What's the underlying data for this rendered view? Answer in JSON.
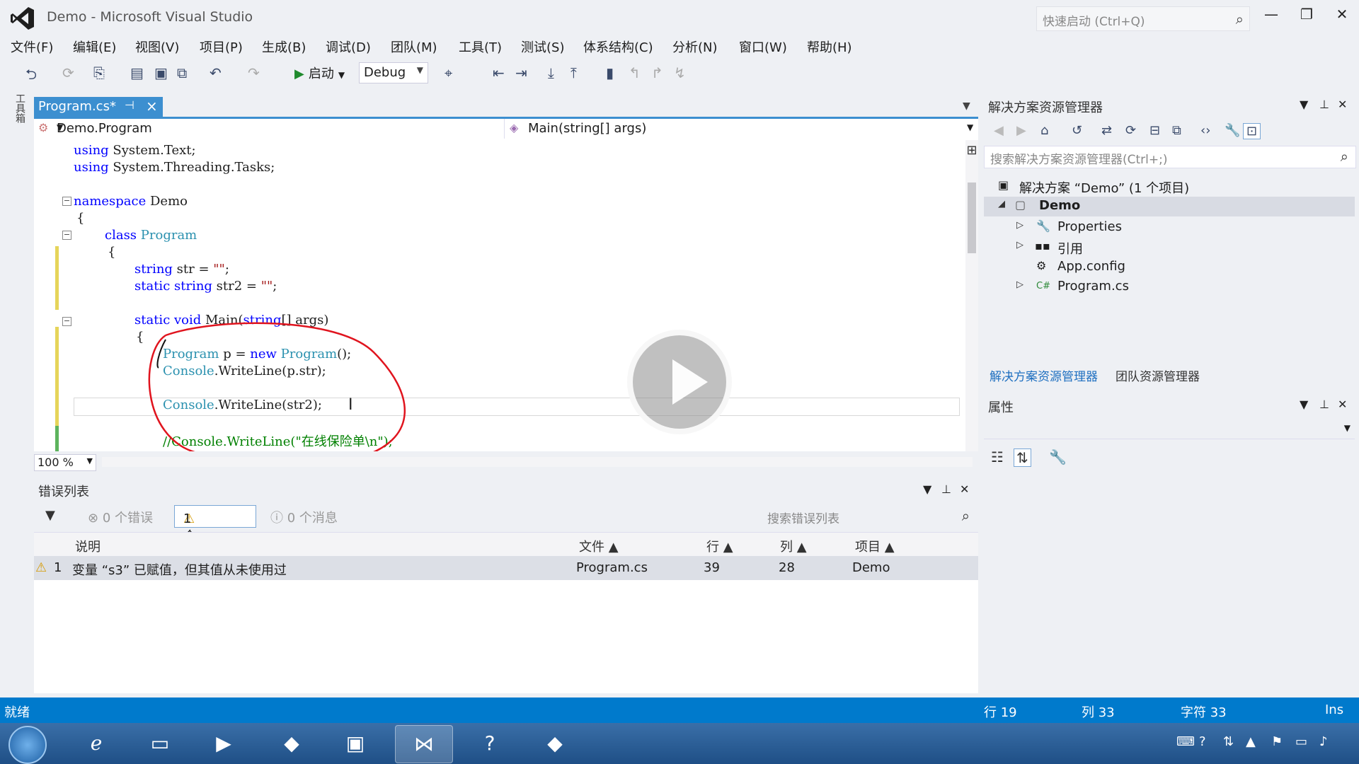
{
  "window": {
    "title": "Demo - Microsoft Visual Studio",
    "quick_launch_placeholder": "快速启动 (Ctrl+Q)",
    "minimize": "—",
    "restore": "❐",
    "close": "✕"
  },
  "menu": [
    "文件(F)",
    "编辑(E)",
    "视图(V)",
    "项目(P)",
    "生成(B)",
    "调试(D)",
    "团队(M)",
    "工具(T)",
    "测试(S)",
    "体系结构(C)",
    "分析(N)",
    "窗口(W)",
    "帮助(H)"
  ],
  "toolbar": {
    "start_label": "启动",
    "config": "Debug"
  },
  "toolbox_label": "工具箱",
  "editor": {
    "tab_label": "Program.cs*",
    "nav_class": "Demo.Program",
    "nav_member": "Main(string[] args)",
    "zoom": "100 %",
    "lines": {
      "l1a": "using",
      "l1b": " System.Text;",
      "l2a": "using",
      "l2b": " System.Threading.Tasks;",
      "l3a": "namespace",
      "l3b": " Demo",
      "l4": "{",
      "l5a": "class",
      "l5b": " Program",
      "l6": "{",
      "l7a": "string",
      "l7b": " str = ",
      "l7c": "\"\"",
      "l7d": ";",
      "l8a": "static string",
      "l8b": " str2 = ",
      "l8c": "\"\"",
      "l8d": ";",
      "l9a": "static void",
      "l9b": " Main(",
      "l9c": "string",
      "l9d": "[] args)",
      "l10": "{",
      "l11a": "Program",
      "l11b": " p = ",
      "l11c": "new",
      "l11d": " ",
      "l11e": "Program",
      "l11f": "();",
      "l12a": "Console",
      "l12b": ".WriteLine(p.str);",
      "l13a": "Console",
      "l13b": ".WriteLine(str2);",
      "l14": "//Console.WriteLine(\"在线保险单\\n\");"
    }
  },
  "solution_explorer": {
    "title": "解决方案资源管理器",
    "search_placeholder": "搜索解决方案资源管理器(Ctrl+;)",
    "solution": "解决方案 “Demo” (1 个项目)",
    "project": "Demo",
    "items": [
      "Properties",
      "引用",
      "App.config",
      "Program.cs"
    ],
    "tab_solution": "解决方案资源管理器",
    "tab_team": "团队资源管理器"
  },
  "properties": {
    "title": "属性"
  },
  "error_list": {
    "title": "错误列表",
    "errors": "0 个错误",
    "warnings": "1 个警告",
    "messages": "0 个消息",
    "search_placeholder": "搜索错误列表",
    "columns": [
      "说明",
      "文件",
      "行",
      "列",
      "项目"
    ],
    "row": {
      "index": "1",
      "description": "变量 “s3” 已赋值，但其值从未使用过",
      "file": "Program.cs",
      "line": "39",
      "col": "28",
      "project": "Demo"
    }
  },
  "status": {
    "ready": "就绪",
    "line": "行 19",
    "col": "列 33",
    "char": "字符 33",
    "mode": "Ins"
  },
  "colors": {
    "accent": "#007acc",
    "tab_active": "#3c8fd0",
    "annotation": "#e0141e"
  }
}
